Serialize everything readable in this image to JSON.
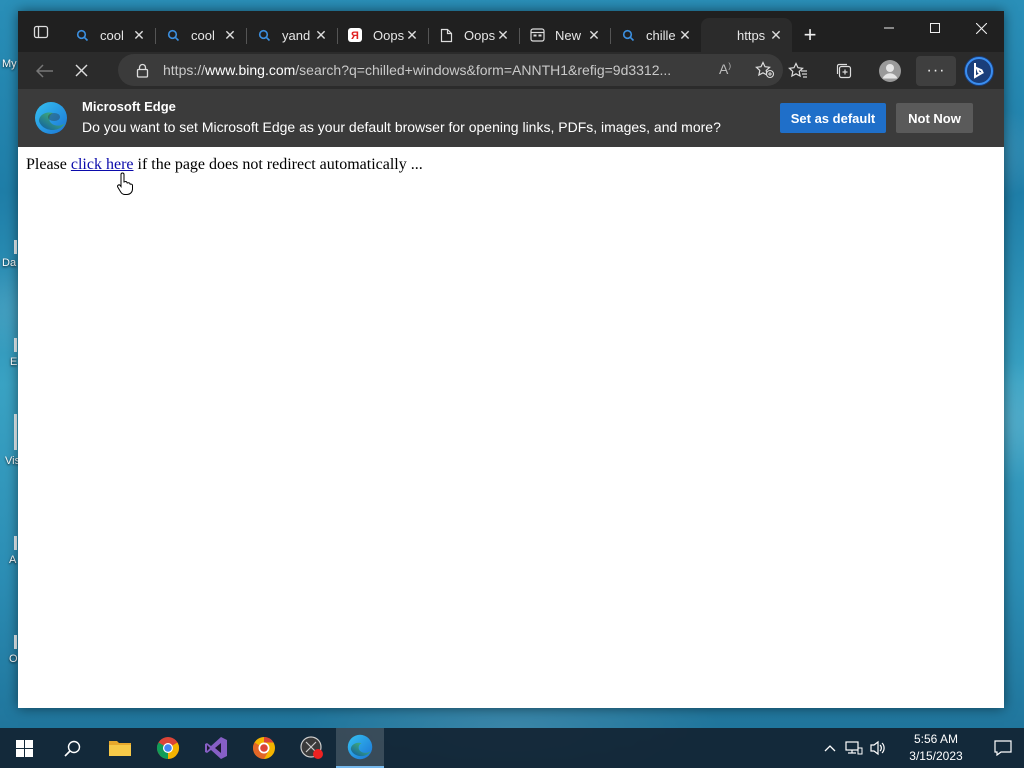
{
  "desktop": {
    "labels": [
      "My",
      "Da",
      "E",
      "Vis",
      "A",
      "O"
    ]
  },
  "tabs": [
    {
      "title": "cool",
      "icon": "search-icon"
    },
    {
      "title": "cool",
      "icon": "search-icon"
    },
    {
      "title": "yand",
      "icon": "search-icon"
    },
    {
      "title": "Oops",
      "icon": "yandex-icon"
    },
    {
      "title": "Oops",
      "icon": "page-icon"
    },
    {
      "title": "New",
      "icon": "newtab-icon"
    },
    {
      "title": "chille",
      "icon": "search-icon"
    },
    {
      "title": "https",
      "icon": "blank-icon"
    }
  ],
  "address": {
    "prefix": "https://",
    "host": "www.bing.com",
    "path": "/search?q=chilled+windows&form=ANNTH1&refig=9d3312..."
  },
  "infobar": {
    "title": "Microsoft Edge",
    "message": "Do you want to set Microsoft Edge as your default browser for opening links, PDFs, images, and more?",
    "set_default_label": "Set as default",
    "not_now_label": "Not Now"
  },
  "page": {
    "before": "Please ",
    "link": "click here",
    "after": " if the page does not redirect automatically ..."
  },
  "taskbar": {
    "time": "5:56 AM",
    "date": "3/15/2023"
  },
  "colors": {
    "accent": "#1f6fc9",
    "titlebar": "#202020",
    "infobar": "#3b3b3b"
  }
}
